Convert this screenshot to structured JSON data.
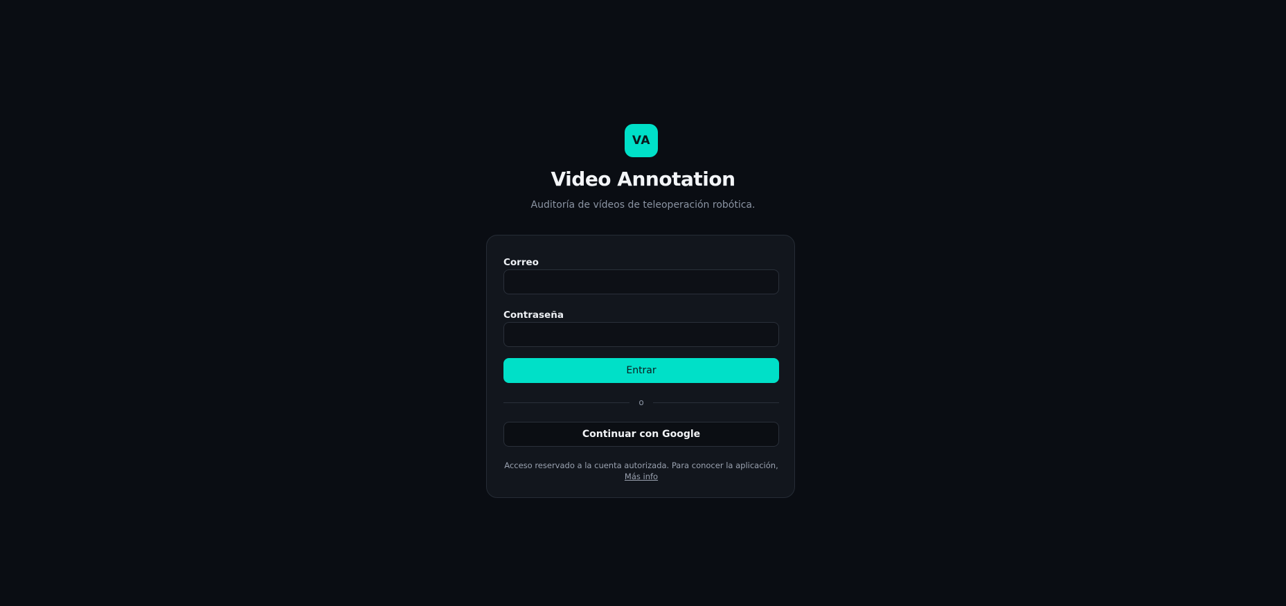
{
  "brand": {
    "logo_text": "VA",
    "title": "Video Annotation",
    "subtitle": "Auditoría de vídeos de teleoperación robótica.",
    "accent_color": "#00e0c8"
  },
  "login_form": {
    "email_label": "Correo",
    "email_value": "",
    "password_label": "Contraseña",
    "password_value": "",
    "submit_label": "Entrar",
    "divider_text": "o",
    "google_label": "Continuar con Google",
    "footer_text": "Acceso reservado a la cuenta autorizada. Para conocer la aplicación, ",
    "more_info_link": "Más info"
  }
}
